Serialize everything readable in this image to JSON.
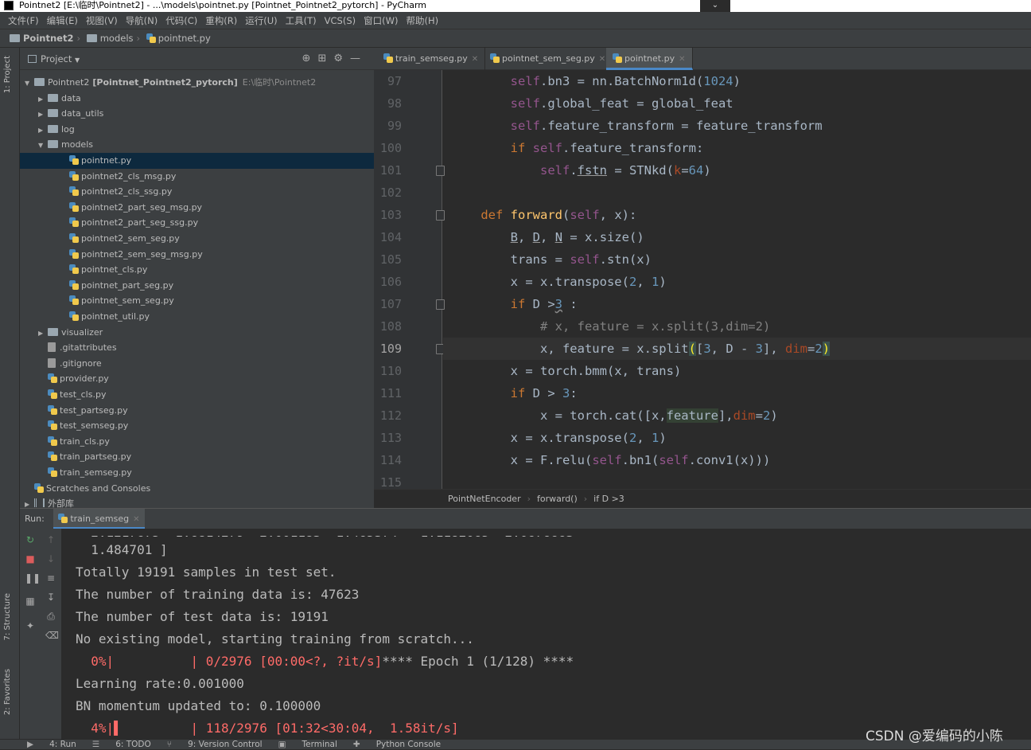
{
  "window": {
    "title": "Pointnet2 [E:\\临时\\Pointnet2] - ...\\models\\pointnet.py [Pointnet_Pointnet2_pytorch] - PyCharm"
  },
  "menu": [
    "文件(F)",
    "编辑(E)",
    "视图(V)",
    "导航(N)",
    "代码(C)",
    "重构(R)",
    "运行(U)",
    "工具(T)",
    "VCS(S)",
    "窗口(W)",
    "帮助(H)"
  ],
  "navbar": {
    "root": "Pointnet2",
    "folder": "models",
    "file": "pointnet.py"
  },
  "left_strip": {
    "project": "1: Project",
    "structure": "7: Structure",
    "favorites": "2: Favorites"
  },
  "project": {
    "header": "Project",
    "tree": [
      {
        "label": "Pointnet2",
        "extra": "[Pointnet_Pointnet2_pytorch]",
        "path": "E:\\临时\\Pointnet2",
        "depth": 0,
        "arrow": "▼",
        "kind": "folder"
      },
      {
        "label": "data",
        "depth": 1,
        "arrow": "▶",
        "kind": "folder"
      },
      {
        "label": "data_utils",
        "depth": 1,
        "arrow": "▶",
        "kind": "folder"
      },
      {
        "label": "log",
        "depth": 1,
        "arrow": "▶",
        "kind": "folder"
      },
      {
        "label": "models",
        "depth": 1,
        "arrow": "▼",
        "kind": "folder"
      },
      {
        "label": "pointnet.py",
        "depth": 2,
        "kind": "py",
        "selected": true
      },
      {
        "label": "pointnet2_cls_msg.py",
        "depth": 2,
        "kind": "py"
      },
      {
        "label": "pointnet2_cls_ssg.py",
        "depth": 2,
        "kind": "py"
      },
      {
        "label": "pointnet2_part_seg_msg.py",
        "depth": 2,
        "kind": "py"
      },
      {
        "label": "pointnet2_part_seg_ssg.py",
        "depth": 2,
        "kind": "py"
      },
      {
        "label": "pointnet2_sem_seg.py",
        "depth": 2,
        "kind": "py"
      },
      {
        "label": "pointnet2_sem_seg_msg.py",
        "depth": 2,
        "kind": "py"
      },
      {
        "label": "pointnet_cls.py",
        "depth": 2,
        "kind": "py"
      },
      {
        "label": "pointnet_part_seg.py",
        "depth": 2,
        "kind": "py"
      },
      {
        "label": "pointnet_sem_seg.py",
        "depth": 2,
        "kind": "py"
      },
      {
        "label": "pointnet_util.py",
        "depth": 2,
        "kind": "py"
      },
      {
        "label": "visualizer",
        "depth": 1,
        "arrow": "▶",
        "kind": "folder"
      },
      {
        "label": ".gitattributes",
        "depth": 1,
        "kind": "git"
      },
      {
        "label": ".gitignore",
        "depth": 1,
        "kind": "git"
      },
      {
        "label": "provider.py",
        "depth": 1,
        "kind": "py"
      },
      {
        "label": "test_cls.py",
        "depth": 1,
        "kind": "py"
      },
      {
        "label": "test_partseg.py",
        "depth": 1,
        "kind": "py"
      },
      {
        "label": "test_semseg.py",
        "depth": 1,
        "kind": "py"
      },
      {
        "label": "train_cls.py",
        "depth": 1,
        "kind": "py"
      },
      {
        "label": "train_partseg.py",
        "depth": 1,
        "kind": "py"
      },
      {
        "label": "train_semseg.py",
        "depth": 1,
        "kind": "py"
      },
      {
        "label": "Scratches and Consoles",
        "depth": 0,
        "kind": "scratch"
      },
      {
        "label": "外部库",
        "depth": 0,
        "arrow": "▶",
        "kind": "lib"
      }
    ]
  },
  "editor": {
    "tabs": [
      {
        "label": "train_semseg.py",
        "active": false
      },
      {
        "label": "pointnet_sem_seg.py",
        "active": false
      },
      {
        "label": "pointnet.py",
        "active": true
      }
    ],
    "line_numbers": [
      "97",
      "98",
      "99",
      "100",
      "101",
      "102",
      "103",
      "104",
      "105",
      "106",
      "107",
      "108",
      "109",
      "110",
      "111",
      "112",
      "113",
      "114",
      "115"
    ],
    "current_line": "109",
    "breadcrumbs": [
      "PointNetEncoder",
      "forward()",
      "if D >3"
    ]
  },
  "run": {
    "label": "Run:",
    "tab": "train_semseg",
    "lines": [
      {
        "text": "  1.484701 ]",
        "color": "normal"
      },
      {
        "text": "Totally 19191 samples in test set.",
        "color": "normal"
      },
      {
        "text": "The number of training data is: 47623",
        "color": "normal"
      },
      {
        "text": "The number of test data is: 19191",
        "color": "normal"
      },
      {
        "text": "No existing model, starting training from scratch...",
        "color": "normal"
      },
      {
        "text": "  0%|          | 0/2976 [00:00<?, ?it/s]",
        "tail": "**** Epoch 1 (1/128) ****",
        "color": "red"
      },
      {
        "text": "Learning rate:0.001000",
        "color": "normal"
      },
      {
        "text": "BN momentum updated to: 0.100000",
        "color": "normal"
      },
      {
        "text": "  4%|▌         | 118/2976 [01:32<30:04,  1.58it/s]",
        "color": "red"
      }
    ]
  },
  "statusbar": [
    "4: Run",
    "6: TODO",
    "9: Version Control",
    "Terminal",
    "Python Console"
  ],
  "watermark": "CSDN @爱编码的小陈"
}
